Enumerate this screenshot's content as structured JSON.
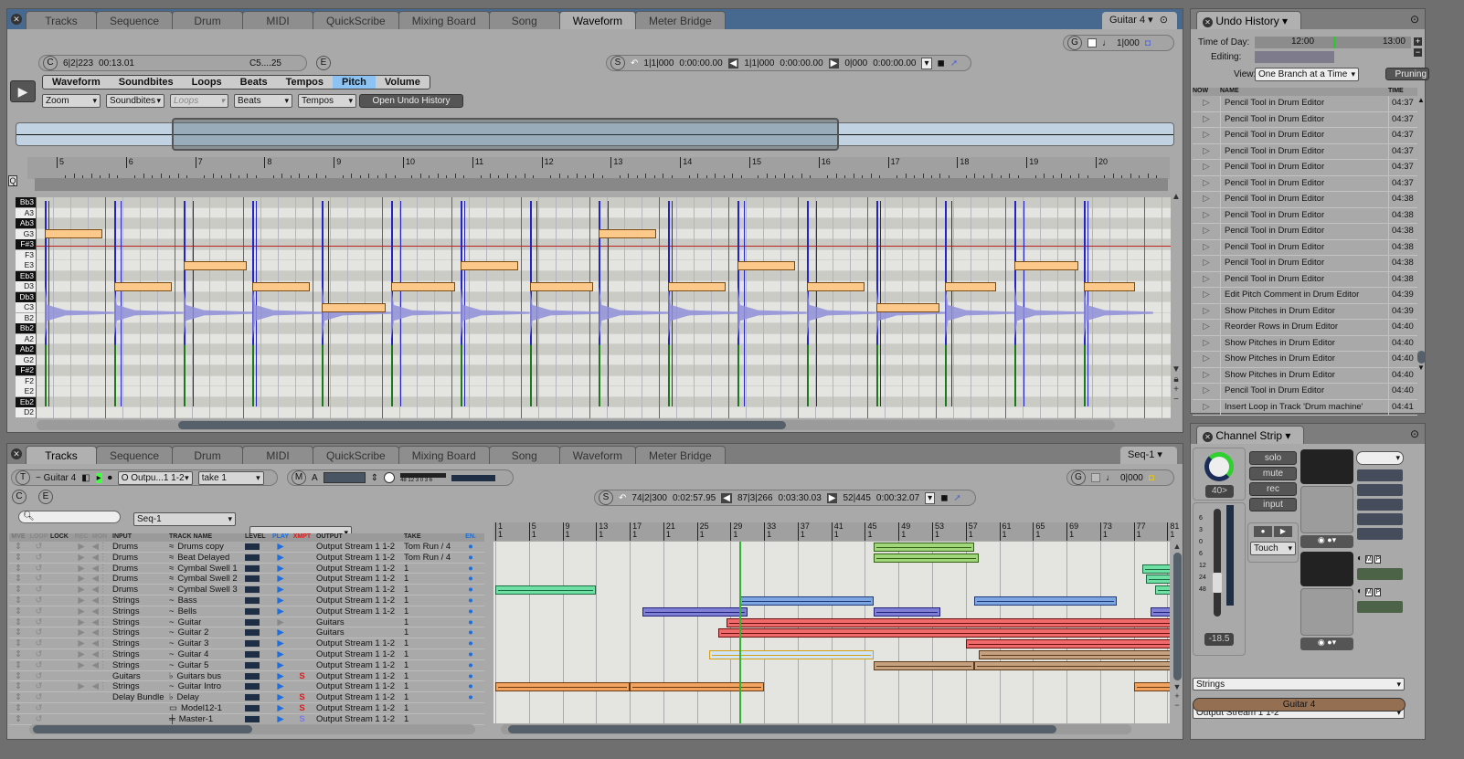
{
  "top_window": {
    "tabs": [
      "Tracks",
      "Sequence",
      "Drum",
      "MIDI",
      "QuickScribe",
      "Mixing Board",
      "Song",
      "Waveform",
      "Meter Bridge"
    ],
    "active_tab": "Waveform",
    "track_menu": "Guitar 4 ▾",
    "counter": {
      "c_label": "C",
      "position": "6|2|223",
      "time": "00:13.01",
      "pitch": "C5....25",
      "e_label": "E"
    },
    "selection": {
      "s_label": "S",
      "start_mbt": "1|1|000",
      "start_time": "0:00:00.00",
      "end_mbt": "1|1|000",
      "end_time": "0:00:00.00",
      "len_mbt": "0|000",
      "len_time": "0:00:00.00"
    },
    "grid": {
      "g_label": "G",
      "value": "1|000"
    },
    "mode_tabs": [
      "Waveform",
      "Soundbites",
      "Loops",
      "Beats",
      "Tempos",
      "Pitch",
      "Volume"
    ],
    "active_mode": "Pitch",
    "dropdowns": [
      "Zoom",
      "Soundbites",
      "Loops",
      "Beats",
      "Tempos"
    ],
    "open_undo_button": "Open Undo History",
    "ruler_marks": [
      "5",
      "6",
      "7",
      "8",
      "9",
      "10",
      "11",
      "12",
      "13",
      "14",
      "15",
      "16",
      "17",
      "18",
      "19",
      "20"
    ],
    "pitch_keys": [
      {
        "name": "Bb3",
        "black": true
      },
      {
        "name": "A3",
        "black": false
      },
      {
        "name": "Ab3",
        "black": true
      },
      {
        "name": "G3",
        "black": false
      },
      {
        "name": "F#3",
        "black": true
      },
      {
        "name": "F3",
        "black": false
      },
      {
        "name": "E3",
        "black": false
      },
      {
        "name": "Eb3",
        "black": true
      },
      {
        "name": "D3",
        "black": false
      },
      {
        "name": "Db3",
        "black": true
      },
      {
        "name": "C3",
        "black": false
      },
      {
        "name": "B2",
        "black": false
      },
      {
        "name": "Bb2",
        "black": true
      },
      {
        "name": "A2",
        "black": false
      },
      {
        "name": "Ab2",
        "black": true
      },
      {
        "name": "G2",
        "black": false
      },
      {
        "name": "F#2",
        "black": true
      },
      {
        "name": "F2",
        "black": false
      },
      {
        "name": "E2",
        "black": false
      },
      {
        "name": "Eb2",
        "black": true
      },
      {
        "name": "D2",
        "black": false
      }
    ],
    "pitch_notes": [
      {
        "start_beat": 0.0,
        "len_beat": 0.9,
        "pitch": "G3"
      },
      {
        "start_beat": 1.0,
        "len_beat": 0.9,
        "pitch": "D3"
      },
      {
        "start_beat": 2.0,
        "len_beat": 1.0,
        "pitch": "E3"
      },
      {
        "start_beat": 3.0,
        "len_beat": 0.9,
        "pitch": "D3"
      },
      {
        "start_beat": 4.0,
        "len_beat": 1.0,
        "pitch": "C3"
      },
      {
        "start_beat": 5.0,
        "len_beat": 1.0,
        "pitch": "D3"
      },
      {
        "start_beat": 6.0,
        "len_beat": 0.9,
        "pitch": "E3"
      },
      {
        "start_beat": 7.0,
        "len_beat": 1.0,
        "pitch": "D3"
      },
      {
        "start_beat": 8.0,
        "len_beat": 0.9,
        "pitch": "G3"
      },
      {
        "start_beat": 9.0,
        "len_beat": 0.9,
        "pitch": "D3"
      },
      {
        "start_beat": 10.0,
        "len_beat": 0.9,
        "pitch": "E3"
      },
      {
        "start_beat": 11.0,
        "len_beat": 0.9,
        "pitch": "D3"
      },
      {
        "start_beat": 12.0,
        "len_beat": 1.0,
        "pitch": "C3"
      },
      {
        "start_beat": 13.0,
        "len_beat": 0.8,
        "pitch": "D3"
      },
      {
        "start_beat": 14.0,
        "len_beat": 1.0,
        "pitch": "E3"
      },
      {
        "start_beat": 15.0,
        "len_beat": 0.8,
        "pitch": "D3"
      }
    ]
  },
  "undo_history": {
    "title": "Undo History",
    "time_of_day_label": "Time of Day:",
    "time_start": "12:00",
    "time_end": "13:00",
    "editing_label": "Editing:",
    "view_label": "View:",
    "view_value": "One Branch at a Time",
    "pruning_button": "Pruning",
    "columns": [
      "NOW",
      "NAME",
      "TIME"
    ],
    "rows": [
      {
        "name": "Pencil Tool in Drum Editor",
        "time": "04:37"
      },
      {
        "name": "Pencil Tool in Drum Editor",
        "time": "04:37"
      },
      {
        "name": "Pencil Tool in Drum Editor",
        "time": "04:37"
      },
      {
        "name": "Pencil Tool in Drum Editor",
        "time": "04:37"
      },
      {
        "name": "Pencil Tool in Drum Editor",
        "time": "04:37"
      },
      {
        "name": "Pencil Tool in Drum Editor",
        "time": "04:37"
      },
      {
        "name": "Pencil Tool in Drum Editor",
        "time": "04:38"
      },
      {
        "name": "Pencil Tool in Drum Editor",
        "time": "04:38"
      },
      {
        "name": "Pencil Tool in Drum Editor",
        "time": "04:38"
      },
      {
        "name": "Pencil Tool in Drum Editor",
        "time": "04:38"
      },
      {
        "name": "Pencil Tool in Drum Editor",
        "time": "04:38"
      },
      {
        "name": "Pencil Tool in Drum Editor",
        "time": "04:38"
      },
      {
        "name": "Edit Pitch Comment in Drum Editor",
        "time": "04:39"
      },
      {
        "name": "Show Pitches in Drum Editor",
        "time": "04:39"
      },
      {
        "name": "Reorder Rows in Drum Editor",
        "time": "04:40"
      },
      {
        "name": "Show Pitches in Drum Editor",
        "time": "04:40"
      },
      {
        "name": "Show Pitches in Drum Editor",
        "time": "04:40"
      },
      {
        "name": "Show Pitches in Drum Editor",
        "time": "04:40"
      },
      {
        "name": "Pencil Tool in Drum Editor",
        "time": "04:40"
      },
      {
        "name": "Insert Loop in Track 'Drum machine'",
        "time": "04:41"
      }
    ]
  },
  "channel_strip": {
    "title": "Channel Strip",
    "pan_value": "40>",
    "buttons": [
      "solo",
      "mute",
      "rec",
      "input"
    ],
    "automation_mode": "Touch",
    "fader_scale": [
      "6",
      "3",
      "0",
      "6",
      "12",
      "24",
      "48"
    ],
    "volume": "-18.5",
    "input_select": "Strings",
    "output_select": "Output Stream 1 1-2",
    "track_name": "Guitar 4"
  },
  "bottom_window": {
    "tabs": [
      "Tracks",
      "Sequence",
      "Drum",
      "MIDI",
      "QuickScribe",
      "Mixing Board",
      "Song",
      "Waveform",
      "Meter Bridge"
    ],
    "active_tab": "Tracks",
    "seq_menu": "Seq-1 ▾",
    "track_bar": {
      "t_label": "T",
      "track": "~ Guitar 4",
      "output": "O Outpu...1 1-2",
      "take": "take 1",
      "m_label": "M",
      "a_label": "A",
      "meter_scale": "48 12 3 0 3 6"
    },
    "c_label": "C",
    "e_label": "E",
    "search_placeholder": "",
    "seq_select": "Seq-1",
    "blank_select": "",
    "selection": {
      "s_label": "S",
      "start_mbt": "74|2|300",
      "start_time": "0:02:57.95",
      "end_mbt": "87|3|266",
      "end_time": "0:03:30.03",
      "len_mbt": "52|445",
      "len_time": "0:00:32.07"
    },
    "grid": {
      "g_label": "G",
      "value": "0|000"
    },
    "columns": [
      "MVE",
      "LOOP",
      "LOCK",
      "REC",
      "MON",
      "INPUT",
      "TRACK NAME",
      "LEVEL",
      "PLAY",
      "XMPT",
      "OUTPUT",
      "TAKE",
      "EN."
    ],
    "tracks": [
      {
        "input": "Drums",
        "icon": "≈",
        "name": "Drums copy",
        "output": "Output Stream 1 1-2",
        "take": "Tom Run / 4",
        "xmpt": "",
        "play": true,
        "rec": true
      },
      {
        "input": "Drums",
        "icon": "≈",
        "name": "Beat Delayed",
        "output": "Output Stream 1 1-2",
        "take": "Tom Run / 4",
        "xmpt": "",
        "play": true,
        "rec": true
      },
      {
        "input": "Drums",
        "icon": "≈",
        "name": "Cymbal Swell 1",
        "output": "Output Stream 1 1-2",
        "take": "1",
        "xmpt": "",
        "play": true,
        "rec": true
      },
      {
        "input": "Drums",
        "icon": "≈",
        "name": "Cymbal Swell 2",
        "output": "Output Stream 1 1-2",
        "take": "1",
        "xmpt": "",
        "play": true,
        "rec": true
      },
      {
        "input": "Drums",
        "icon": "≈",
        "name": "Cymbal Swell 3",
        "output": "Output Stream 1 1-2",
        "take": "1",
        "xmpt": "",
        "play": true,
        "rec": true
      },
      {
        "input": "Strings",
        "icon": "~",
        "name": "Bass",
        "output": "Output Stream 1 1-2",
        "take": "1",
        "xmpt": "",
        "play": true,
        "rec": true
      },
      {
        "input": "Strings",
        "icon": "~",
        "name": "Bells",
        "output": "Output Stream 1 1-2",
        "take": "1",
        "xmpt": "",
        "play": true,
        "rec": true
      },
      {
        "input": "Strings",
        "icon": "~",
        "name": "Guitar",
        "output": "Guitars",
        "take": "1",
        "xmpt": "",
        "play": false,
        "rec": true
      },
      {
        "input": "Strings",
        "icon": "~",
        "name": "Guitar 2",
        "output": "Guitars",
        "take": "1",
        "xmpt": "",
        "play": true,
        "rec": true
      },
      {
        "input": "Strings",
        "icon": "~",
        "name": "Guitar 3",
        "output": "Output Stream 1 1-2",
        "take": "1",
        "xmpt": "",
        "play": true,
        "rec": true
      },
      {
        "input": "Strings",
        "icon": "~",
        "name": "Guitar 4",
        "output": "Output Stream 1 1-2",
        "take": "1",
        "xmpt": "",
        "play": true,
        "rec": true
      },
      {
        "input": "Strings",
        "icon": "~",
        "name": "Guitar 5",
        "output": "Output Stream 1 1-2",
        "take": "1",
        "xmpt": "",
        "play": true,
        "rec": true
      },
      {
        "input": "Guitars",
        "icon": "♭",
        "name": "Guitars bus",
        "output": "Output Stream 1 1-2",
        "take": "1",
        "xmpt": "S",
        "play": true,
        "rec": false
      },
      {
        "input": "Strings",
        "icon": "~",
        "name": "Guitar Intro",
        "output": "Output Stream 1 1-2",
        "take": "1",
        "xmpt": "",
        "play": true,
        "rec": true
      },
      {
        "input": "Delay Bundle",
        "icon": "♭",
        "name": "Delay",
        "output": "Output Stream 1 1-2",
        "take": "1",
        "xmpt": "S",
        "play": true,
        "rec": false
      },
      {
        "input": "",
        "icon": "▭",
        "name": "Model12-1",
        "output": "Output Stream 1 1-2",
        "take": "1",
        "xmpt": "S",
        "play": true,
        "rec": false
      },
      {
        "input": "",
        "icon": "╪",
        "name": "Master-1",
        "output": "Output Stream 1 1-2",
        "take": "1",
        "xmpt": "S",
        "play": true,
        "rec": false
      }
    ],
    "ruler_marks": [
      "1",
      "5",
      "9",
      "13",
      "17",
      "21",
      "25",
      "29",
      "33",
      "37",
      "41",
      "45",
      "49",
      "53",
      "57",
      "61",
      "65",
      "69",
      "73",
      "77",
      "81"
    ],
    "playhead_measure": 30,
    "clips": [
      {
        "row": 0,
        "start": 46,
        "end": 58,
        "color": "#9fd77a",
        "border": "#335f12"
      },
      {
        "row": 1,
        "start": 46,
        "end": 58.5,
        "color": "#9fd77a",
        "border": "#335f12"
      },
      {
        "row": 2,
        "start": 78,
        "end": 82,
        "color": "#6fe0a4",
        "border": "#1c6b43"
      },
      {
        "row": 3,
        "start": 78.5,
        "end": 82,
        "color": "#6fe0a4",
        "border": "#1c6b43"
      },
      {
        "row": 4,
        "start": 1,
        "end": 13,
        "color": "#6fe0a4",
        "border": "#1c6b43"
      },
      {
        "row": 4,
        "start": 79.5,
        "end": 82,
        "color": "#6fe0a4",
        "border": "#1c6b43"
      },
      {
        "row": 5,
        "start": 30,
        "end": 46,
        "color": "#7da6e0",
        "border": "#1c3a7d"
      },
      {
        "row": 5,
        "start": 58,
        "end": 75,
        "color": "#7da6e0",
        "border": "#1c3a7d"
      },
      {
        "row": 6,
        "start": 18.5,
        "end": 31,
        "color": "#7f7fd6",
        "border": "#22227a"
      },
      {
        "row": 6,
        "start": 46,
        "end": 54,
        "color": "#7f7fd6",
        "border": "#22227a"
      },
      {
        "row": 6,
        "start": 79,
        "end": 82,
        "color": "#7f7fd6",
        "border": "#22227a"
      },
      {
        "row": 7,
        "start": 28.5,
        "end": 82,
        "color": "#ef6b6b",
        "border": "#6d0e0e"
      },
      {
        "row": 8,
        "start": 27.5,
        "end": 82,
        "color": "#ef6b6b",
        "border": "#6d0e0e"
      },
      {
        "row": 9,
        "start": 57,
        "end": 82,
        "color": "#ef6b6b",
        "border": "#6d0e0e"
      },
      {
        "row": 10,
        "start": 26.5,
        "end": 46,
        "color": "#cfe5f7",
        "border": "#d5a010"
      },
      {
        "row": 10,
        "start": 58.5,
        "end": 82,
        "color": "#c6a180",
        "border": "#5a3a1a"
      },
      {
        "row": 11,
        "start": 46,
        "end": 58,
        "color": "#c6a180",
        "border": "#5a3a1a"
      },
      {
        "row": 11,
        "start": 58,
        "end": 82,
        "color": "#c6a180",
        "border": "#5a3a1a"
      },
      {
        "row": 13,
        "start": 1,
        "end": 17,
        "color": "#f2a35f",
        "border": "#6b3a0f"
      },
      {
        "row": 13,
        "start": 17,
        "end": 33,
        "color": "#f2a35f",
        "border": "#6b3a0f"
      },
      {
        "row": 13,
        "start": 77,
        "end": 82,
        "color": "#f2a35f",
        "border": "#6b3a0f"
      }
    ]
  }
}
